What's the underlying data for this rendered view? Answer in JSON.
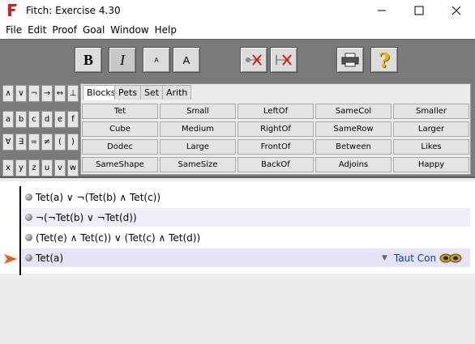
{
  "window": {
    "title": "Fitch: Exercise 4.30"
  },
  "menubar": {
    "items": [
      "File",
      "Edit",
      "Proof",
      "Goal",
      "Window",
      "Help"
    ]
  },
  "toolbar": {
    "bold_label": "B",
    "italic_label": "I",
    "small_font_label": "A",
    "large_font_label": "A"
  },
  "symbols": [
    [
      "∧",
      "∨",
      "¬",
      "→",
      "↔",
      "⊥"
    ],
    [
      "a",
      "b",
      "c",
      "d",
      "e",
      "f"
    ],
    [
      "∀",
      "∃",
      "=",
      "≠",
      "(",
      ")"
    ],
    [
      "x",
      "y",
      "z",
      "u",
      "v",
      "w"
    ]
  ],
  "tabs": [
    "Blocks",
    "Pets",
    "Set",
    "Arith"
  ],
  "active_tab": "Blocks",
  "predicates": [
    [
      "Tet",
      "Small",
      "LeftOf",
      "SameCol",
      "Smaller"
    ],
    [
      "Cube",
      "Medium",
      "RightOf",
      "SameRow",
      "Larger"
    ],
    [
      "Dodec",
      "Large",
      "FrontOf",
      "Between",
      "Likes"
    ],
    [
      "SameShape",
      "SameSize",
      "BackOf",
      "Adjoins",
      "Happy"
    ]
  ],
  "proof": {
    "lines": [
      {
        "sentence": "Tet(a) ∨ ¬(Tet(b) ∧ Tet(c))"
      },
      {
        "sentence": "¬(¬Tet(b) ∨ ¬Tet(d))"
      },
      {
        "sentence": "(Tet(e) ∧ Tet(c)) ∨ (Tet(c) ∧ Tet(d))"
      },
      {
        "sentence": "Tet(a)"
      }
    ],
    "rule_label": "Taut Con"
  },
  "colors": {
    "toolbar_bg": "#7a7a7a",
    "rule_text": "#1a3aa0",
    "focus_arrow": "#e06010"
  }
}
